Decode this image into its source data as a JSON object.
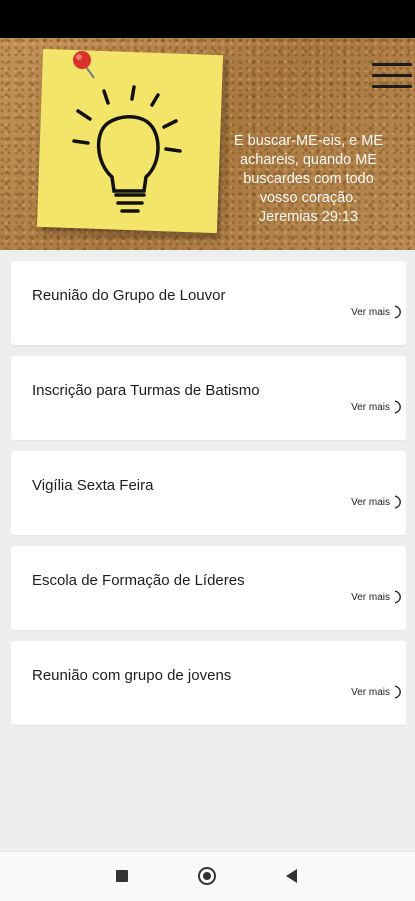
{
  "header": {
    "quote_lines": [
      "E buscar-ME-eis, e ME",
      "achareis, quando ME",
      "buscardes com todo",
      "vosso coração."
    ],
    "reference": "Jeremias 29:13",
    "menu_icon": "hamburger-menu-icon",
    "image_icons": [
      "light-bulb-icon",
      "push-pin-icon"
    ]
  },
  "events": [
    {
      "title": "Reunião do Grupo de Louvor",
      "action": "Ver mais"
    },
    {
      "title": "Inscrição para Turmas de Batismo",
      "action": "Ver mais"
    },
    {
      "title": "Vigília Sexta Feira",
      "action": "Ver mais"
    },
    {
      "title": "Escola de Formação de Líderes",
      "action": "Ver mais"
    },
    {
      "title": "Reunião com grupo de jovens",
      "action": "Ver mais"
    }
  ],
  "navigation": {
    "icons": [
      "recent-apps-icon",
      "home-icon",
      "back-icon"
    ]
  },
  "colors": {
    "status_bar": "#000000",
    "note": "#f3e56a",
    "cork": "#b8874f",
    "card": "#ffffff",
    "background": "#eeeeee"
  }
}
